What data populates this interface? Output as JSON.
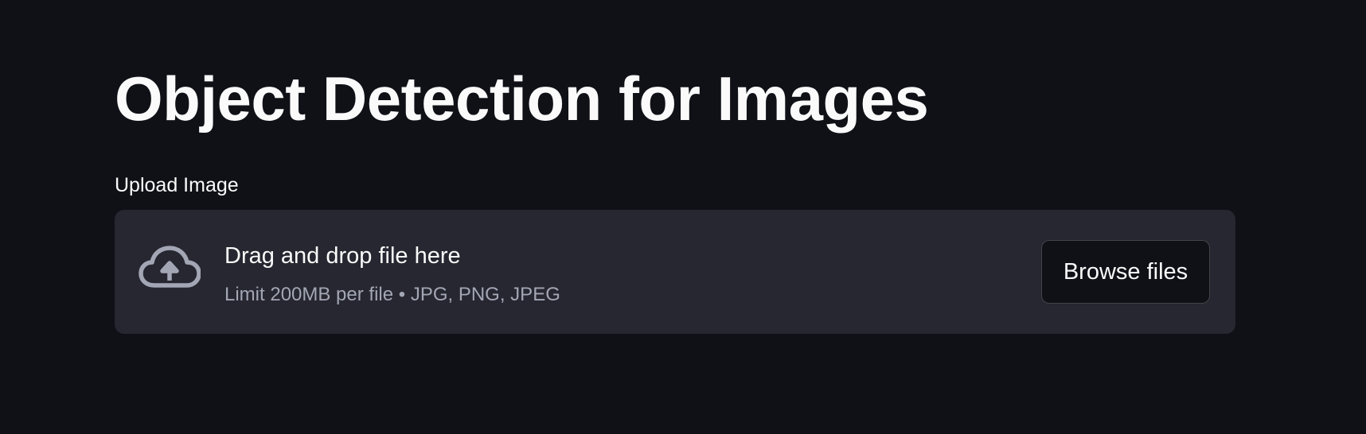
{
  "page": {
    "title": "Object Detection for Images"
  },
  "uploader": {
    "label": "Upload Image",
    "dropzone_title": "Drag and drop file here",
    "dropzone_subtitle": "Limit 200MB per file • JPG, PNG, JPEG",
    "browse_button_label": "Browse files",
    "icon": "cloud-upload-icon"
  },
  "colors": {
    "background": "#0f1117",
    "dropzone_background": "#262730",
    "text": "#fafafa",
    "muted_text": "#a3a6b4",
    "icon": "#a3a6b4"
  }
}
